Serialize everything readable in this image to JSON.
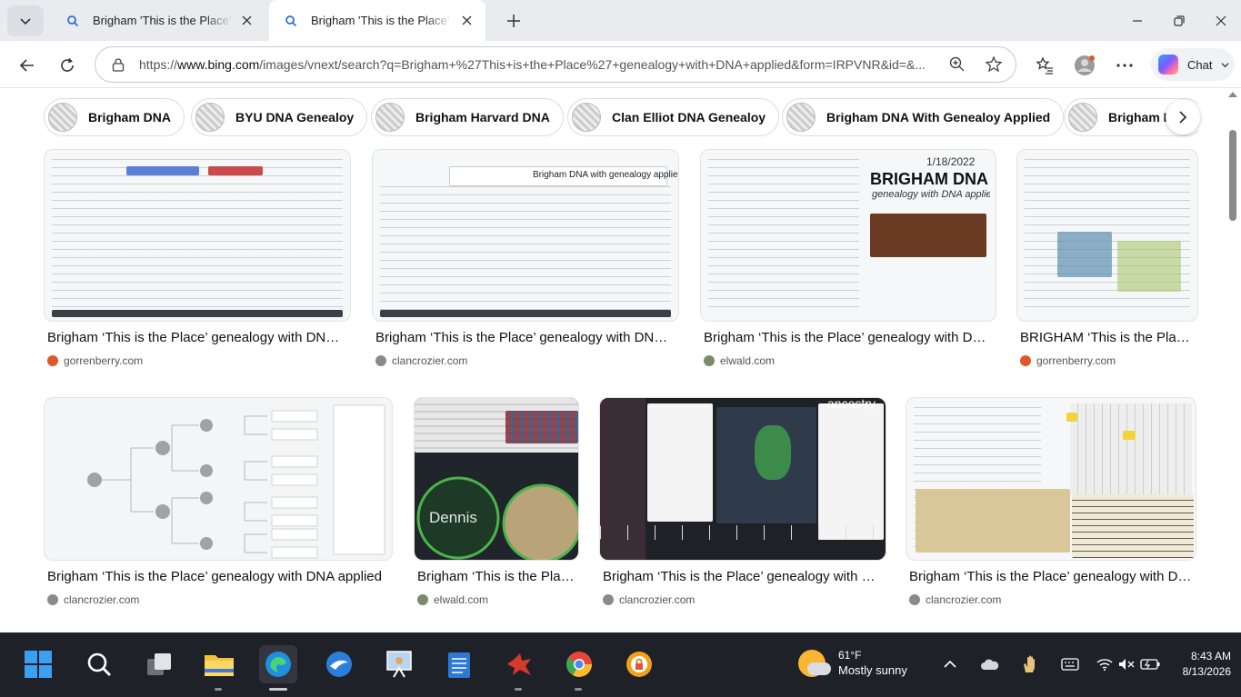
{
  "browser": {
    "tabs": [
      {
        "title": "Brigham 'This is the Place' genealogy with DNA applied - Search",
        "active": false
      },
      {
        "title": "Brigham 'This is the Place' genealogy with DNA applied - Search",
        "active": true
      }
    ],
    "url_prefix": "https://",
    "url_host": "www.bing.com",
    "url_path": "/images/vnext/search?q=Brigham+%27This+is+the+Place%27+genealogy+with+DNA+applied&form=IRPVNR&id=&...",
    "chat_label": "Chat"
  },
  "chips": [
    {
      "label": "Brigham DNA"
    },
    {
      "label": "BYU DNA Genealoy"
    },
    {
      "label": "Brigham Harvard DNA"
    },
    {
      "label": "Clan Elliot DNA Genealoy"
    },
    {
      "label": "Brigham DNA With Genealoy Applied"
    },
    {
      "label": "Brigham DNA"
    }
  ],
  "results": [
    {
      "caption": "Brigham ‘This is the Place’ genealogy with DNA applied",
      "source": "gorrenberry.com",
      "source_color": "#e0572a"
    },
    {
      "caption": "Brigham ‘This is the Place’ genealogy with DNA applied",
      "source": "clancrozier.com",
      "source_color": "#8a8a8a"
    },
    {
      "caption": "Brigham ‘This is the Place’ genealogy with DNA applied",
      "source": "elwald.com",
      "source_color": "#7a8a6a"
    },
    {
      "caption": "BRIGHAM ‘This is the Place’ genealogy with DNA applied",
      "source": "gorrenberry.com",
      "source_color": "#e0572a"
    },
    {
      "caption": "Brigham ‘This is the Place’ genealogy with DNA applied",
      "source": "clancrozier.com",
      "source_color": "#8a8a8a"
    },
    {
      "caption": "Brigham ‘This is the Place’ genealogy with DNA applied",
      "source": "elwald.com",
      "source_color": "#7a8a6a"
    },
    {
      "caption": "Brigham ‘This is the Place’ genealogy with DNA applied",
      "source": "clancrozier.com",
      "source_color": "#8a8a8a"
    },
    {
      "caption": "Brigham ‘This is the Place’ genealogy with DNA applied",
      "source": "clancrozier.com",
      "source_color": "#8a8a8a"
    }
  ],
  "image_text": {
    "r1_i2_banner": "Brigham DNA with genealogy applied",
    "r1_i3_date": "1/18/2022",
    "r1_i3_title": "BRIGHAM DNA",
    "r1_i3_sub": "genealogy with DNA applied.",
    "r2_i2_name": "Dennis",
    "r2_i3_brand": "ancestry"
  },
  "taskbar": {
    "weather_temp": "61°F",
    "weather_cond": "Mostly sunny",
    "time": "8:43 AM",
    "date": "8/13/2026"
  }
}
